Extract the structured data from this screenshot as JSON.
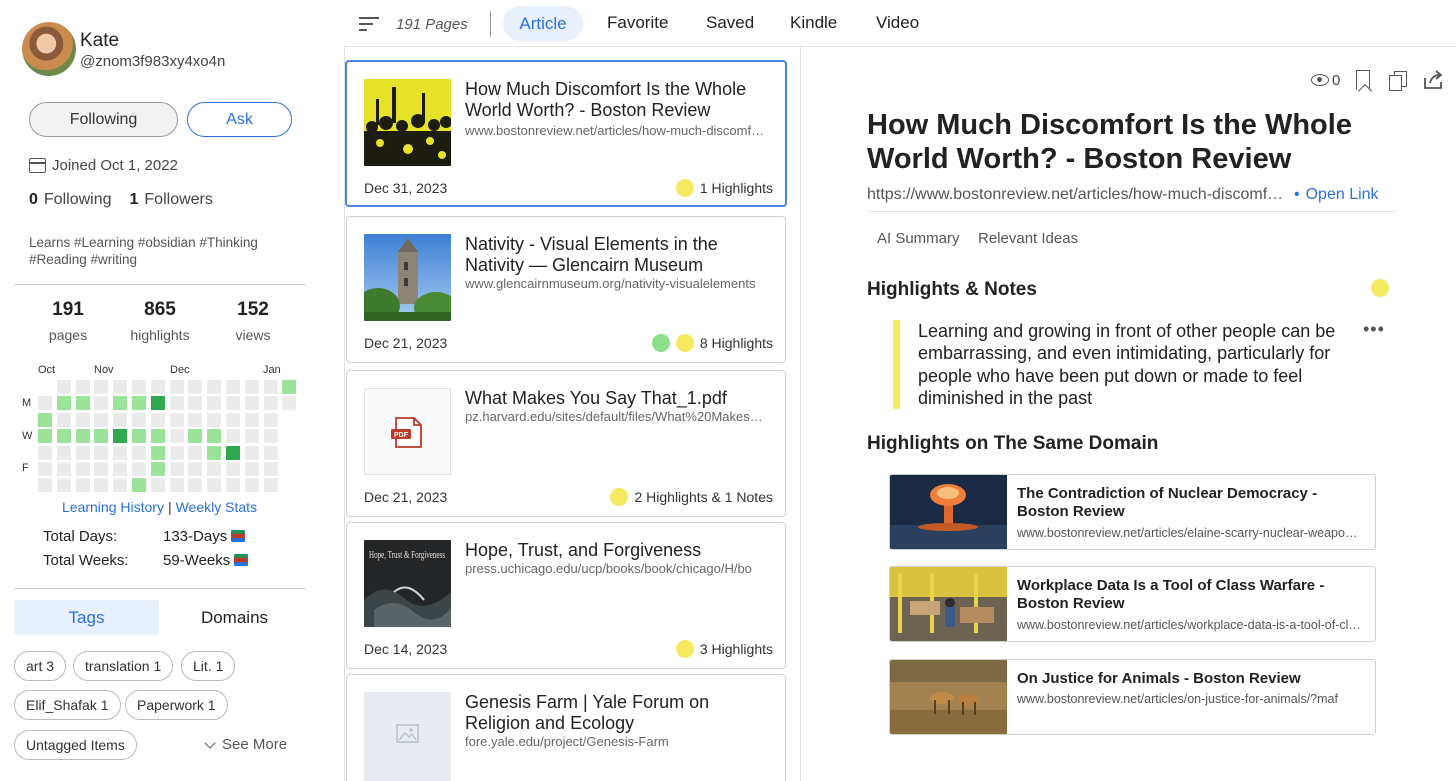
{
  "profile": {
    "name": "Kate",
    "handle": "@znom3f983xy4xo4n",
    "following_button": "Following",
    "ask_button": "Ask",
    "joined": "Joined Oct 1, 2022",
    "following_count": "0",
    "following_label": "Following",
    "followers_count": "1",
    "followers_label": "Followers",
    "bio": "Learns #Learning #obsidian #Thinking #Reading #writing"
  },
  "stats": {
    "pages_num": "191",
    "pages_label": "pages",
    "highlights_num": "865",
    "highlights_label": "highlights",
    "views_num": "152",
    "views_label": "views"
  },
  "heatmap": {
    "months": [
      "Oct",
      "Nov",
      "Dec",
      "Jan"
    ],
    "days": [
      "M",
      "W",
      "F"
    ],
    "levels": [
      [
        -1,
        0,
        0,
        0,
        0,
        0,
        0,
        0,
        0,
        0,
        0,
        0,
        0,
        1
      ],
      [
        0,
        1,
        1,
        0,
        1,
        1,
        3,
        0,
        0,
        0,
        0,
        0,
        0,
        0
      ],
      [
        1,
        0,
        0,
        0,
        0,
        0,
        0,
        0,
        0,
        0,
        0,
        0,
        0,
        -1
      ],
      [
        1,
        1,
        1,
        1,
        3,
        1,
        1,
        0,
        1,
        1,
        0,
        0,
        0,
        -1
      ],
      [
        0,
        0,
        0,
        0,
        0,
        0,
        1,
        0,
        0,
        1,
        3,
        0,
        0,
        -1
      ],
      [
        0,
        0,
        0,
        0,
        0,
        0,
        1,
        0,
        0,
        0,
        0,
        0,
        0,
        -1
      ],
      [
        0,
        0,
        0,
        0,
        0,
        1,
        0,
        0,
        0,
        0,
        0,
        0,
        0,
        -1
      ]
    ],
    "colors": {
      "empty": "#ebebeb",
      "low": "#9be39b",
      "mid": "#5fcf70",
      "high": "#2fa84f"
    }
  },
  "links": {
    "history": "Learning History",
    "separator": "|",
    "weekly": "Weekly Stats"
  },
  "totals": {
    "days_label": "Total Days:",
    "days_value": "133-Days",
    "weeks_label": "Total Weeks:",
    "weeks_value": "59-Weeks"
  },
  "tabs": {
    "tags": "Tags",
    "domains": "Domains"
  },
  "chips": [
    "art 3",
    "translation 1",
    "Lit. 1",
    "Elif_Shafak 1",
    "Paperwork 1",
    "Untagged Items"
  ],
  "see_more": "See More",
  "toolbar": {
    "pages_count": "191 Pages",
    "tabs": [
      "Article",
      "Favorite",
      "Saved",
      "Kindle",
      "Video"
    ]
  },
  "cards": [
    {
      "title": "How Much Discomfort Is the Whole World Worth? - Boston Review",
      "url": "www.bostonreview.net/articles/how-much-discomfort-is-the-whole-world-worth",
      "date": "Dec 31, 2023",
      "highlights": "1 Highlights",
      "dots": [
        "yellow"
      ]
    },
    {
      "title": "Nativity - Visual Elements in the Nativity — Glencairn Museum",
      "url": "www.glencairnmuseum.org/nativity-visualelements",
      "date": "Dec 21, 2023",
      "highlights": "8 Highlights",
      "dots": [
        "green",
        "yellow"
      ]
    },
    {
      "title": "What Makes You Say That_1.pdf",
      "url": "pz.harvard.edu/sites/default/files/What%20Makes%20You%20Say%20That",
      "date": "Dec 21, 2023",
      "highlights": "2 Highlights & 1 Notes",
      "dots": [
        "yellow"
      ],
      "pdf_label": "PDF"
    },
    {
      "title": "Hope, Trust, and Forgiveness",
      "url": "press.uchicago.edu/ucp/books/book/chicago/H/bo",
      "date": "Dec 14, 2023",
      "highlights": "3 Highlights",
      "dots": [
        "yellow"
      ],
      "book_text": "Hope, Trust & Forgiveness"
    },
    {
      "title": "Genesis Farm | Yale Forum on Religion and Ecology",
      "url": "fore.yale.edu/project/Genesis-Farm",
      "date": "",
      "highlights": "",
      "dots": []
    }
  ],
  "detail": {
    "views": "0",
    "title": "How Much Discomfort Is the Whole World Worth? - Boston Review",
    "url": "https://www.bostonreview.net/articles/how-much-discomfort-is-the-whole-world-worth/",
    "open_link": "Open Link",
    "subtabs": [
      "AI Summary",
      "Relevant Ideas"
    ],
    "highlights_heading": "Highlights & Notes",
    "quote": "Learning and growing in front of other people can be embarrassing, and even intimidating, particularly for people who have been put down or made to feel diminished in the past",
    "same_domain_heading": "Highlights on The Same Domain",
    "related": [
      {
        "title": "The Contradiction of Nuclear Democracy - Boston Review",
        "url": "www.bostonreview.net/articles/elaine-scarry-nuclear-weapons-democracy"
      },
      {
        "title": "Workplace Data Is a Tool of Class Warfare - Boston Review",
        "url": "www.bostonreview.net/articles/workplace-data-is-a-tool-of-class-warfare"
      },
      {
        "title": "On Justice for Animals - Boston Review",
        "url": "www.bostonreview.net/articles/on-justice-for-animals/?maf"
      }
    ]
  },
  "colors": {
    "accent": "#2a6fdb",
    "highlight": "#f5e960",
    "green_dot": "#8be08b"
  }
}
